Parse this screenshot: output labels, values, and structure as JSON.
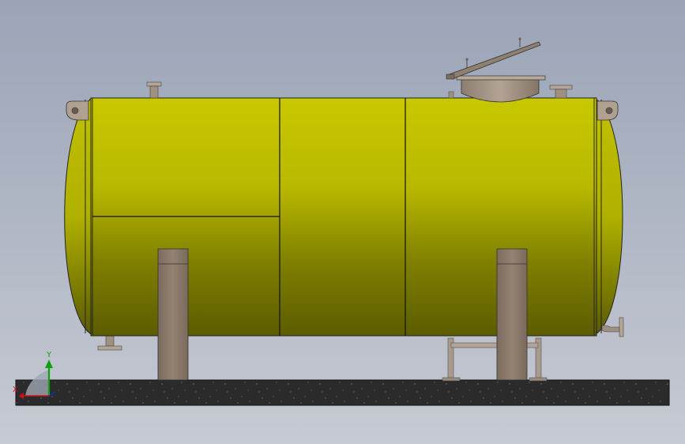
{
  "viewport": {
    "background_top": "#9aa4b6",
    "background_bottom": "#c6cad3"
  },
  "model": {
    "tank_color": "#c4c400",
    "tank_dark": "#5e5e00",
    "leg_color": "#8c7a6a",
    "base_color": "#2a2a2a",
    "pipe_color": "#a99a8c"
  },
  "triad": {
    "x_label": "X",
    "y_label": "Y",
    "x_color": "#d01010",
    "y_color": "#10a010",
    "z_color": "#1030c0"
  }
}
